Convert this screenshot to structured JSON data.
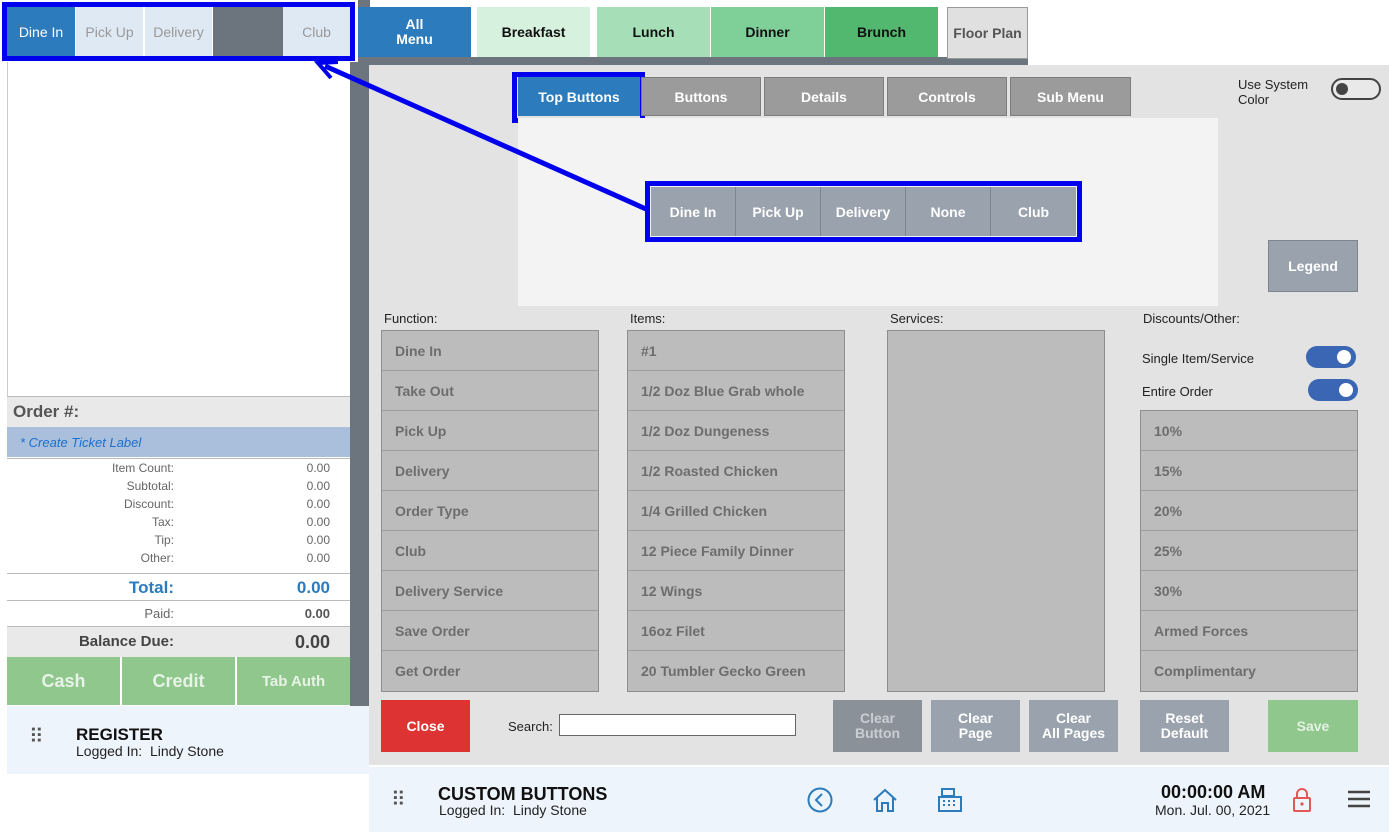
{
  "order_type_bar": {
    "buttons": [
      {
        "label": "Dine In",
        "active": true
      },
      {
        "label": "Pick Up",
        "active": false
      },
      {
        "label": "Delivery",
        "active": false
      },
      {
        "label": "",
        "active": false
      },
      {
        "label": "Club",
        "active": false
      }
    ]
  },
  "menu_tabs": [
    {
      "label": "All\nMenu",
      "color": "#2b7bbd"
    },
    {
      "label": "Breakfast",
      "color": "#d7f1df"
    },
    {
      "label": "Lunch",
      "color": "#a6dfb7"
    },
    {
      "label": "Dinner",
      "color": "#7fcf98"
    },
    {
      "label": "Brunch",
      "color": "#52b76f"
    },
    {
      "label": "Floor Plan",
      "color": "#e0e0e0"
    }
  ],
  "order_panel": {
    "order_label": "Order #:",
    "ticket_label": "* Create Ticket Label",
    "totals": [
      {
        "label": "Item Count:",
        "value": "0.00"
      },
      {
        "label": "Subtotal:",
        "value": "0.00"
      },
      {
        "label": "Discount:",
        "value": "0.00"
      },
      {
        "label": "Tax:",
        "value": "0.00"
      },
      {
        "label": "Tip:",
        "value": "0.00"
      },
      {
        "label": "Other:",
        "value": "0.00"
      }
    ],
    "total_label": "Total:",
    "total_value": "0.00",
    "paid_label": "Paid:",
    "paid_value": "0.00",
    "balance_label": "Balance Due:",
    "balance_value": "0.00",
    "pay_buttons": [
      "Cash",
      "Credit",
      "Tab Auth"
    ]
  },
  "register_bar": {
    "title": "REGISTER",
    "logged_in": "Logged In:  Lindy Stone"
  },
  "dialog": {
    "config_tabs": [
      {
        "label": "Top Buttons",
        "active": true
      },
      {
        "label": "Buttons",
        "active": false
      },
      {
        "label": "Details",
        "active": false
      },
      {
        "label": "Controls",
        "active": false
      },
      {
        "label": "Sub Menu",
        "active": false
      }
    ],
    "use_system_color_label": "Use System\nColor",
    "use_system_color_on": false,
    "preview_buttons": [
      "Dine In",
      "Pick Up",
      "Delivery",
      "None",
      "Club"
    ],
    "legend_label": "Legend",
    "function_header": "Function:",
    "function_items": [
      "Dine In",
      "Take Out",
      "Pick Up",
      "Delivery",
      "Order Type",
      "Club",
      "Delivery Service",
      "Save Order",
      "Get Order"
    ],
    "items_header": "Items:",
    "items": [
      "#1",
      "1/2 Doz Blue Grab whole",
      "1/2 Doz Dungeness",
      "1/2 Roasted Chicken",
      "1/4 Grilled Chicken",
      "12 Piece Family Dinner",
      "12 Wings",
      "16oz Filet",
      "20 Tumbler Gecko Green"
    ],
    "services_header": "Services:",
    "discounts_header": "Discounts/Other:",
    "single_item_label": "Single Item/Service",
    "single_item_on": true,
    "entire_order_label": "Entire Order",
    "entire_order_on": true,
    "discount_items": [
      "10%",
      "15%",
      "20%",
      "25%",
      "30%",
      "Armed Forces",
      "Complimentary"
    ],
    "close_label": "Close",
    "search_label": "Search:",
    "search_value": "",
    "clear_button_label": "Clear\nButton",
    "clear_page_label": "Clear\nPage",
    "clear_all_label": "Clear\nAll Pages",
    "reset_default_label": "Reset\nDefault",
    "save_label": "Save"
  },
  "status_bar": {
    "title": "CUSTOM BUTTONS",
    "logged_in": "Logged In:  Lindy Stone",
    "time": "00:00:00 AM",
    "date": "Mon. Jul. 00, 2021"
  },
  "colors": {
    "accent_blue": "#2b7bbd",
    "highlight": "#0000ee",
    "close_red": "#dd3333",
    "save_green": "#8fc78d",
    "lock_red": "#e05858"
  }
}
